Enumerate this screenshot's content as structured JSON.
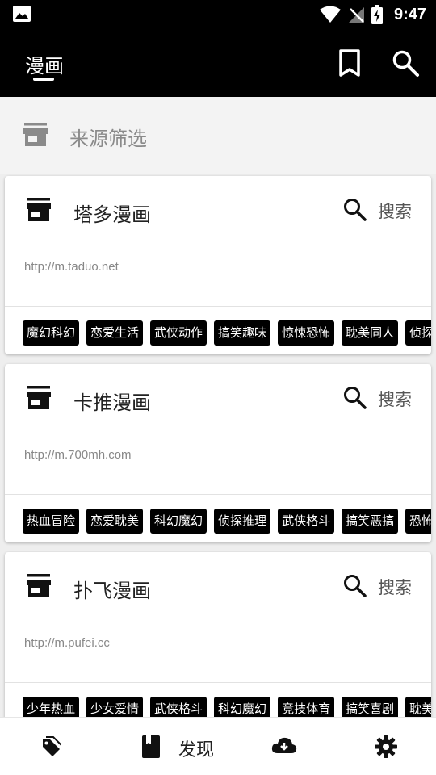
{
  "status_bar": {
    "time": "9:47"
  },
  "app_bar": {
    "title": "漫画"
  },
  "filter": {
    "label": "来源筛选"
  },
  "search_label": "搜索",
  "sources": [
    {
      "title": "塔多漫画",
      "url": "http://m.taduo.net",
      "tags": [
        "魔幻科幻",
        "恋爱生活",
        "武侠动作",
        "搞笑趣味",
        "惊悚恐怖",
        "耽美同人",
        "侦探推理"
      ]
    },
    {
      "title": "卡推漫画",
      "url": "http://m.700mh.com",
      "tags": [
        "热血冒险",
        "恋爱耽美",
        "科幻魔幻",
        "侦探推理",
        "武侠格斗",
        "搞笑恶搞",
        "恐怖灵异"
      ]
    },
    {
      "title": "扑飞漫画",
      "url": "http://m.pufei.cc",
      "tags": [
        "少年热血",
        "少女爱情",
        "武侠格斗",
        "科幻魔幻",
        "竞技体育",
        "搞笑喜剧",
        "耽美人生"
      ]
    }
  ],
  "bottom_nav": {
    "discover_label": "发现"
  }
}
